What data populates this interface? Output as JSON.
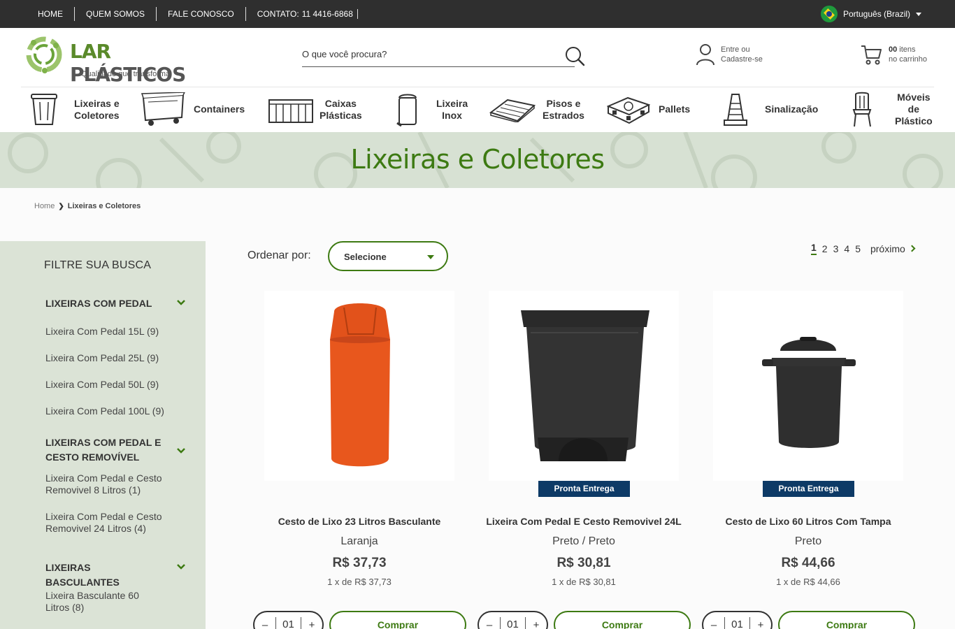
{
  "topbar": {
    "links": [
      "HOME",
      "QUEM SOMOS",
      "FALE CONOSCO"
    ],
    "contact_label": "CONTATO:",
    "contact_phone": "11 4416-6868",
    "language": "Português (Brazil)"
  },
  "header": {
    "logo_name_part1": "LAR",
    "logo_name_part2": " PLÁSTICOS",
    "logo_tagline": "Qualidade que transforma",
    "search_placeholder": "O que você procura?",
    "account_line1": "Entre ou",
    "account_line2": "Cadastre-se",
    "cart_count": "00",
    "cart_line1_suffix": " itens",
    "cart_line2": "no carrinho"
  },
  "categories": [
    {
      "label": "Lixeiras e\nColetores",
      "icon": "bin-icon"
    },
    {
      "label": "Containers",
      "icon": "container-icon"
    },
    {
      "label": "Caixas\nPlásticas",
      "icon": "crate-icon"
    },
    {
      "label": "Lixeira\nInox",
      "icon": "inox-bin-icon"
    },
    {
      "label": "Pisos e\nEstrados",
      "icon": "floor-icon"
    },
    {
      "label": "Pallets",
      "icon": "pallet-icon"
    },
    {
      "label": "Sinalização",
      "icon": "cone-icon"
    },
    {
      "label": "Móveis\nde\nPlástico",
      "icon": "chair-icon"
    }
  ],
  "banner": {
    "title": "Lixeiras e Coletores"
  },
  "breadcrumb": {
    "home": "Home",
    "current": "Lixeiras e Coletores"
  },
  "filters": {
    "title": "FILTRE SUA BUSCA",
    "groups": [
      {
        "title": "LIXEIRAS COM PEDAL",
        "items": [
          "Lixeira Com Pedal 15L (9)",
          "Lixeira Com Pedal 25L (9)",
          "Lixeira Com Pedal 50L (9)",
          "Lixeira Com Pedal 100L (9)"
        ]
      },
      {
        "title": "LIXEIRAS COM PEDAL E CESTO REMOVÍVEL",
        "items": [
          "Lixeira Com Pedal e Cesto Removivel 8 Litros (1)",
          "Lixeira Com Pedal e Cesto Removivel 24 Litros (4)"
        ]
      },
      {
        "title": "LIXEIRAS BASCULANTES",
        "items": [
          "Lixeira Basculante 60 Litros (8)"
        ]
      }
    ]
  },
  "sort": {
    "label": "Ordenar por:",
    "selected": "Selecione"
  },
  "pagination": {
    "pages": [
      "1",
      "2",
      "3",
      "4",
      "5"
    ],
    "next": "próximo"
  },
  "products": [
    {
      "name": "Cesto de Lixo 23 Litros Basculante",
      "color": "Laranja",
      "price": "R$ 37,73",
      "installments": "1 x de R$ 37,73",
      "badge": "",
      "qty": "01",
      "buy": "Comprar",
      "product_color": "#e2521b"
    },
    {
      "name": "Lixeira Com Pedal E Cesto Removivel 24L",
      "color": "Preto / Preto",
      "price": "R$ 30,81",
      "installments": "1 x de R$ 30,81",
      "badge": "Pronta Entrega",
      "qty": "01",
      "buy": "Comprar",
      "product_color": "#2a2a2a"
    },
    {
      "name": "Cesto de Lixo 60 Litros Com Tampa",
      "color": "Preto",
      "price": "R$ 44,66",
      "installments": "1 x de R$ 44,66",
      "badge": "Pronta Entrega",
      "qty": "01",
      "buy": "Comprar",
      "product_color": "#2a2a2a"
    }
  ],
  "colors": {
    "brand_green": "#3d7a12",
    "badge_blue": "#0d3a66",
    "topbar": "#2f2f2f",
    "sidebar": "#dbe3d6"
  }
}
